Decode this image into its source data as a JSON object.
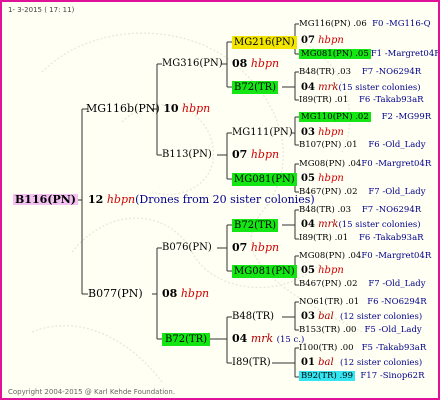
{
  "header": {
    "date": "1- 3-2015 ( 17: 11)"
  },
  "footer": {
    "copyright": "Copyright 2004-2015 @ Karl Kehde Foundation."
  },
  "root": {
    "label": "B116(PN)",
    "year": "12",
    "breed": "hbpn",
    "note": "(Drones from 20 sister colonies)"
  },
  "gen1": {
    "top": {
      "label": "MG116b(PN)",
      "year": "10",
      "breed": "hbpn"
    },
    "bottom": {
      "label": "B077(PN)",
      "year": "08",
      "breed": "hbpn"
    }
  },
  "gen2": {
    "a": {
      "label": "MG316(PN)",
      "year": "08",
      "breed": "hbpn"
    },
    "b": {
      "label": "B113(PN)",
      "year": "07",
      "breed": "hbpn"
    },
    "c": {
      "label": "B076(PN)",
      "year": "07",
      "breed": "hbpn"
    },
    "d": {
      "label": "B72(TR)",
      "year": "04",
      "breed": "mrk",
      "note": "(15 c.)"
    }
  },
  "gen3": {
    "a1": {
      "label": "MG216(PN)"
    },
    "a2": {
      "label": "B72(TR)"
    },
    "b1": {
      "label": "MG111(PN)"
    },
    "b2": {
      "label": "MG081(PN)"
    },
    "c1": {
      "label": "B72(TR)"
    },
    "c2": {
      "label": "MG081(PN)"
    },
    "d1": {
      "label": "B48(TR)"
    },
    "d2": {
      "label": "I89(TR)"
    }
  },
  "gen4": [
    {
      "name": "MG116(PN)",
      "yr": ".06",
      "code": "F0 -MG116-Q"
    },
    {
      "year": "07",
      "breed": "hbpn"
    },
    {
      "name": "MG081(PN)",
      "yr": ".05",
      "code": "F1 -Margret04R"
    },
    {
      "name": "B48(TR)",
      "yr": ".03",
      "code": "F7 -NO6294R"
    },
    {
      "year": "04",
      "breed": "mrk",
      "note": "(15 sister colonies)"
    },
    {
      "name": "I89(TR)",
      "yr": ".01",
      "code": "F6 -Takab93aR"
    },
    {
      "name": "MG110(PN)",
      "yr": ".02",
      "code": "F2 -MG99R"
    },
    {
      "year": "03",
      "breed": "hbpn"
    },
    {
      "name": "B107(PN)",
      "yr": ".01",
      "code": "F6 -Old_Lady"
    },
    {
      "name": "MG08(PN)",
      "yr": ".04",
      "code": "F0 -Margret04R"
    },
    {
      "year": "05",
      "breed": "hbpn"
    },
    {
      "name": "B467(PN)",
      "yr": ".02",
      "code": "F7 -Old_Lady"
    },
    {
      "name": "B48(TR)",
      "yr": ".03",
      "code": "F7 -NO6294R"
    },
    {
      "year": "04",
      "breed": "mrk",
      "note": "(15 sister colonies)"
    },
    {
      "name": "I89(TR)",
      "yr": ".01",
      "code": "F6 -Takab93aR"
    },
    {
      "name": "MG08(PN)",
      "yr": ".04",
      "code": "F0 -Margret04R"
    },
    {
      "year": "05",
      "breed": "hbpn"
    },
    {
      "name": "B467(PN)",
      "yr": ".02",
      "code": "F7 -Old_Lady"
    },
    {
      "name": "NO61(TR)",
      "yr": ".01",
      "code": "F6 -NO6294R"
    },
    {
      "year": "03",
      "breed": "bal",
      "note": "(12 sister colonies)"
    },
    {
      "name": "B153(TR)",
      "yr": ".00",
      "code": "F5 -Old_Lady"
    },
    {
      "name": "I100(TR)",
      "yr": ".00",
      "code": "F5 -Takab93aR"
    },
    {
      "year": "01",
      "breed": "bal",
      "note": "(12 sister colonies)"
    },
    {
      "name": "B92(TR)",
      "yr": ".99",
      "code": "F17 -Sinop62R"
    }
  ]
}
